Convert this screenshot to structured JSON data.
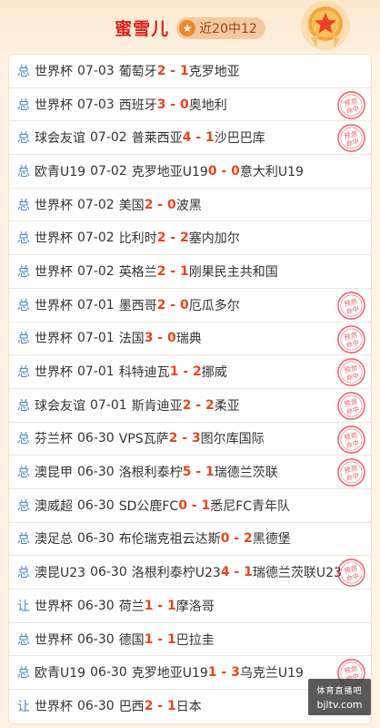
{
  "header": {
    "name": "蜜雪儿",
    "record": "近20中12",
    "star": "★",
    "star_icon": "star-icon",
    "medal_icon": "medal-icon"
  },
  "colors": {
    "name": "#d8241c",
    "score": "#e8451c",
    "type": "#4a84c9",
    "stamp": "#e8333a"
  },
  "rows": [
    {
      "type": "总",
      "league": "世界杯",
      "date": "07-03",
      "home": "葡萄牙",
      "score": "2 - 1",
      "away": "克罗地亚",
      "hit": false
    },
    {
      "type": "总",
      "league": "世界杯",
      "date": "07-03",
      "home": "西班牙",
      "score": "3 - 0",
      "away": "奥地利",
      "hit": true
    },
    {
      "type": "总",
      "league": "球会友谊",
      "date": "07-02",
      "home": "普莱西亚",
      "score": "4 - 1",
      "away": "沙巴巴库",
      "hit": true
    },
    {
      "type": "总",
      "league": "欧青U19",
      "date": "07-02",
      "home": "克罗地亚U19",
      "score": "0 - 0",
      "away": "意大利U19",
      "hit": false
    },
    {
      "type": "总",
      "league": "世界杯",
      "date": "07-02",
      "home": "美国",
      "score": "2 - 0",
      "away": "波黑",
      "hit": false
    },
    {
      "type": "总",
      "league": "世界杯",
      "date": "07-02",
      "home": "比利时",
      "score": "2 - 2",
      "away": "塞内加尔",
      "hit": false
    },
    {
      "type": "总",
      "league": "世界杯",
      "date": "07-02",
      "home": "英格兰",
      "score": "2 - 1",
      "away": "刚果民主共和国",
      "hit": false
    },
    {
      "type": "总",
      "league": "世界杯",
      "date": "07-01",
      "home": "墨西哥",
      "score": "2 - 0",
      "away": "厄瓜多尔",
      "hit": true
    },
    {
      "type": "总",
      "league": "世界杯",
      "date": "07-01",
      "home": "法国",
      "score": "3 - 0",
      "away": "瑞典",
      "hit": true
    },
    {
      "type": "总",
      "league": "世界杯",
      "date": "07-01",
      "home": "科特迪瓦",
      "score": "1 - 2",
      "away": "挪威",
      "hit": true
    },
    {
      "type": "总",
      "league": "球会友谊",
      "date": "07-01",
      "home": "斯肯迪亚",
      "score": "2 - 2",
      "away": "柔亚",
      "hit": true
    },
    {
      "type": "总",
      "league": "芬兰杯",
      "date": "06-30",
      "home": "VPS瓦萨",
      "score": "2 - 3",
      "away": "图尔库国际",
      "hit": true
    },
    {
      "type": "总",
      "league": "澳昆甲",
      "date": "06-30",
      "home": "洛根利泰柠",
      "score": "5 - 1",
      "away": "瑞德兰茨联",
      "hit": true
    },
    {
      "type": "总",
      "league": "澳威超",
      "date": "06-30",
      "home": "SD公鹿FC",
      "score": "0 - 1",
      "away": "悉尼FC青年队",
      "hit": false
    },
    {
      "type": "总",
      "league": "澳足总",
      "date": "06-30",
      "home": "布伦瑞克祖云达斯",
      "score": "0 - 2",
      "away": "黑德堡",
      "hit": false
    },
    {
      "type": "总",
      "league": "澳昆U23",
      "date": "06-30",
      "home": "洛根利泰柠U23",
      "score": "4 - 1",
      "away": "瑞德兰茨联U23",
      "hit": true
    },
    {
      "type": "让",
      "league": "世界杯",
      "date": "06-30",
      "home": "荷兰",
      "score": "1 - 1",
      "away": "摩洛哥",
      "hit": false
    },
    {
      "type": "总",
      "league": "世界杯",
      "date": "06-30",
      "home": "德国",
      "score": "1 - 1",
      "away": "巴拉圭",
      "hit": false
    },
    {
      "type": "总",
      "league": "欧青U19",
      "date": "06-30",
      "home": "克罗地亚U19",
      "score": "1 - 3",
      "away": "乌克兰U19",
      "hit": true
    },
    {
      "type": "让",
      "league": "世界杯",
      "date": "06-30",
      "home": "巴西",
      "score": "2 - 1",
      "away": "日本",
      "hit": false
    }
  ],
  "stamp_text": "预测命中",
  "watermark": {
    "top": "体育直播吧",
    "bottom": "bjltv.com"
  }
}
